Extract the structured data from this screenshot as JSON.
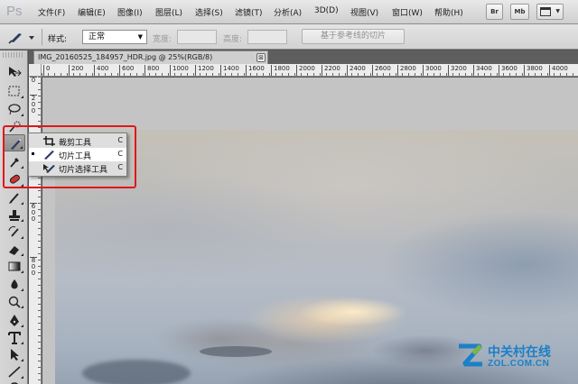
{
  "app": {
    "logo": "Ps"
  },
  "menubar": {
    "items": [
      "文件(F)",
      "编辑(E)",
      "图像(I)",
      "图层(L)",
      "选择(S)",
      "滤镜(T)",
      "分析(A)",
      "3D(D)",
      "视图(V)",
      "窗口(W)",
      "帮助(H)"
    ],
    "app_buttons": [
      "Br",
      "Mb"
    ],
    "screen_mode_icon": "screen-mode-icon"
  },
  "options": {
    "style_label": "样式:",
    "style_value": "正常",
    "width_label": "宽度:",
    "height_label": "高度:",
    "guides_button": "基于参考线的切片"
  },
  "document": {
    "tab_title": "IMG_20160525_184957_HDR.jpg @ 25%(RGB/8)",
    "close": "⊠"
  },
  "rulers": {
    "horizontal": [
      "0",
      "200",
      "400",
      "600",
      "800",
      "1000",
      "1200",
      "1400",
      "1600",
      "1800",
      "2000",
      "2200",
      "2400",
      "2600",
      "2800",
      "3000",
      "3200",
      "3400",
      "3600",
      "3800",
      "4000"
    ],
    "vertical": [
      "0",
      "200",
      "400",
      "600",
      "800"
    ]
  },
  "flyout": {
    "items": [
      {
        "label": "裁剪工具",
        "shortcut": "C",
        "icon": "crop-icon",
        "selected": false
      },
      {
        "label": "切片工具",
        "shortcut": "C",
        "icon": "slice-icon",
        "selected": true
      },
      {
        "label": "切片选择工具",
        "shortcut": "C",
        "icon": "slice-select-icon",
        "selected": false
      }
    ]
  },
  "tools": [
    "move-icon",
    "marquee-icon",
    "lasso-icon",
    "quick-select-icon",
    "slice-icon",
    "eyedropper-icon",
    "healing-brush-icon",
    "brush-icon",
    "clone-stamp-icon",
    "history-brush-icon",
    "eraser-icon",
    "gradient-icon",
    "blur-icon",
    "dodge-icon",
    "pen-icon",
    "type-icon",
    "path-select-icon",
    "line-icon",
    "hand-icon"
  ],
  "watermark": {
    "name": "中关村在线",
    "url": "ZOL.COM.CN"
  },
  "colors": {
    "highlight": "#e0161c",
    "watermark": "#1b80c8"
  }
}
